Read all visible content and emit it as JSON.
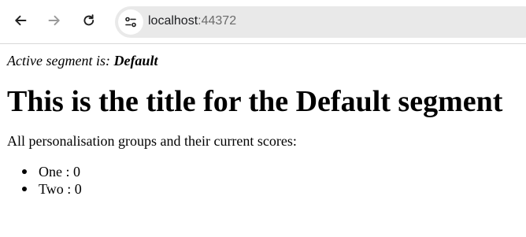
{
  "browser": {
    "url_host": "localhost",
    "url_port": ":44372",
    "icons": {
      "back": "arrow-left-icon",
      "forward": "arrow-right-icon",
      "reload": "reload-icon",
      "site_info": "tune-icon"
    }
  },
  "page": {
    "active_prefix": "Active segment is: ",
    "active_segment": "Default",
    "title": "This is the title for the Default segment",
    "intro": "All personalisation groups and their current scores:",
    "groups": [
      {
        "name": "One",
        "separator": " : ",
        "score": "0"
      },
      {
        "name": "Two",
        "separator": " : ",
        "score": "0"
      }
    ]
  }
}
